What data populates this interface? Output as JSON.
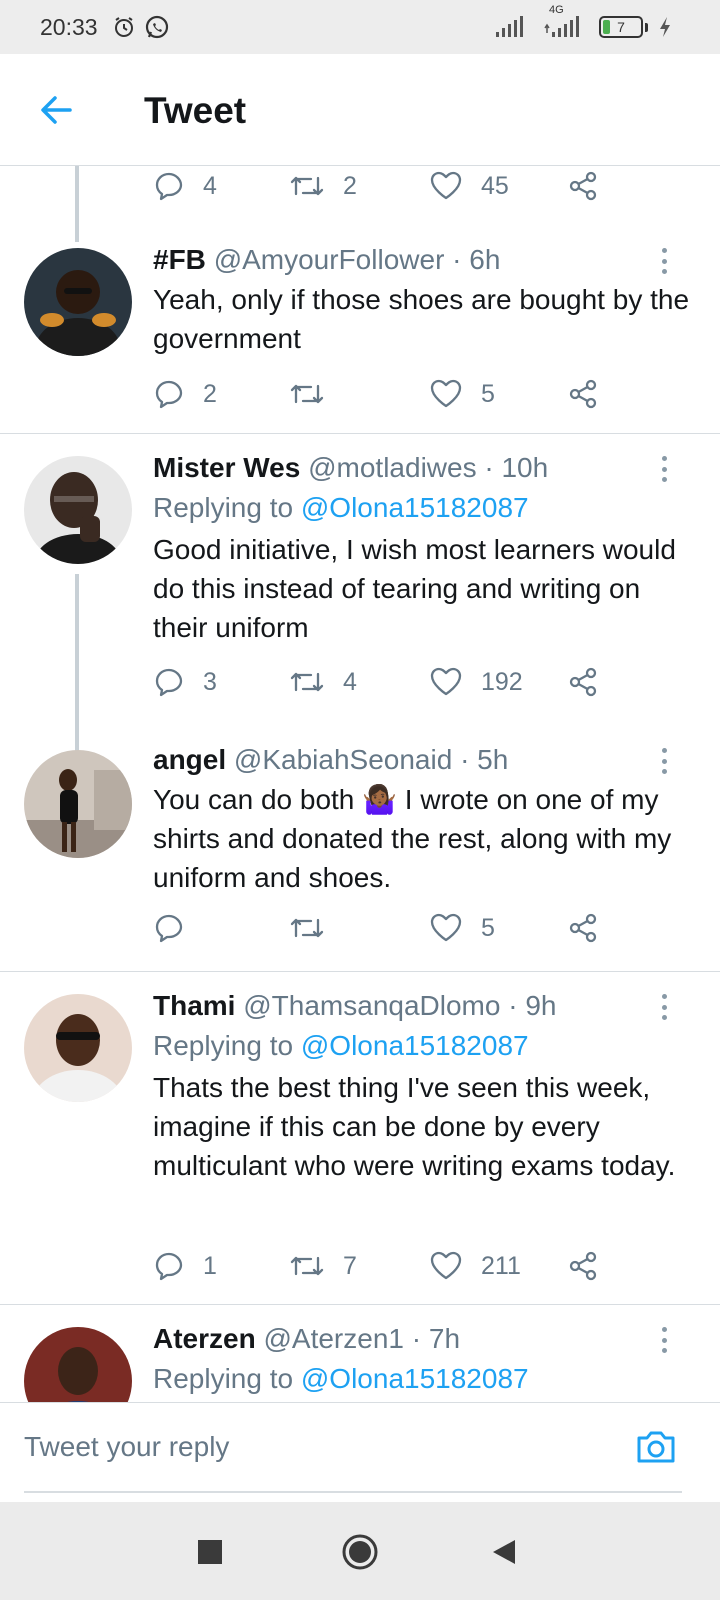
{
  "status_bar": {
    "time": "20:33",
    "network": "4G",
    "battery_level": "7",
    "icons": [
      "alarm-icon",
      "whatsapp-icon",
      "signal-icon",
      "signal-4g-icon",
      "battery-icon",
      "charging-icon"
    ]
  },
  "header": {
    "title": "Tweet",
    "back_icon": "arrow-left-icon"
  },
  "colors": {
    "accent": "#1da1f2",
    "text": "#14171a",
    "muted": "#657786",
    "divider": "#d8dde1"
  },
  "top_actions": {
    "replies": "4",
    "retweets": "2",
    "likes": "45"
  },
  "tweets": [
    {
      "name": "#FB",
      "handle": "@AmyourFollower",
      "time": "· 6h",
      "replying_to": "",
      "text": "Yeah, only if those shoes are bought by the government",
      "replies": "2",
      "retweets": "",
      "likes": "5"
    },
    {
      "name": "Mister Wes",
      "handle": "@motladiwes",
      "time": "· 10h",
      "replying_label": "Replying to",
      "replying_to": "@Olona15182087",
      "text": "Good initiative, I wish most learners would do this instead of tearing and writing on their uniform",
      "replies": "3",
      "retweets": "4",
      "likes": "192"
    },
    {
      "name": "angel",
      "handle": "@KabiahSeonaid",
      "time": "· 5h",
      "replying_to": "",
      "text": "You can do both 🤷🏾‍♀️ I wrote on one of my shirts and donated the rest, along with my uniform and shoes.",
      "replies": "",
      "retweets": "",
      "likes": "5"
    },
    {
      "name": "Thami",
      "handle": "@ThamsanqaDlomo",
      "time": "· 9h",
      "replying_label": "Replying to",
      "replying_to": "@Olona15182087",
      "text": "Thats the best thing I've seen this week, imagine if this can be done by every multiculant who were writing exams today.",
      "replies": "1",
      "retweets": "7",
      "likes": "211"
    },
    {
      "name": "Aterzen",
      "handle": "@Aterzen1",
      "time": "· 7h",
      "replying_label": "Replying to",
      "replying_to": "@Olona15182087",
      "text": "",
      "replies": "",
      "retweets": "",
      "likes": ""
    }
  ],
  "reply_bar": {
    "placeholder": "Tweet your reply",
    "camera_icon": "camera-icon"
  },
  "nav_bar": {
    "icons": [
      "square-recents-icon",
      "circle-home-icon",
      "triangle-back-icon"
    ]
  }
}
